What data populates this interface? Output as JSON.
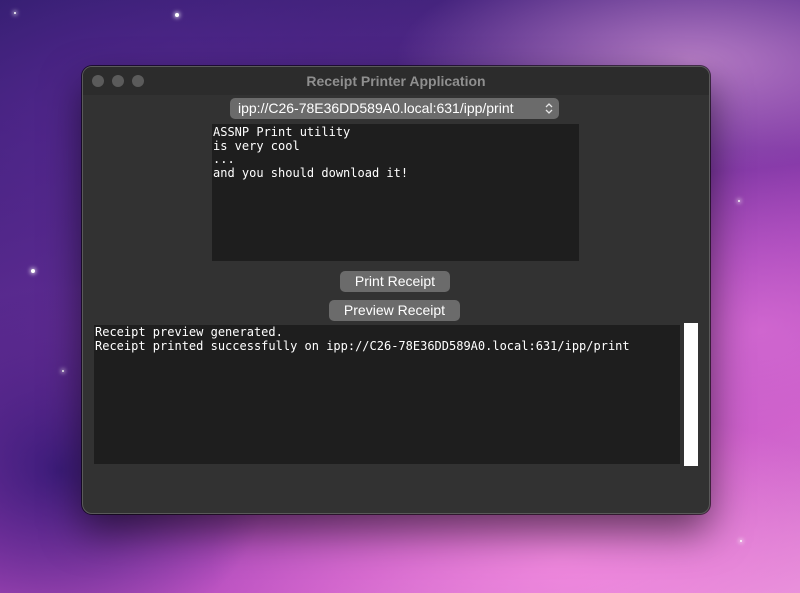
{
  "window": {
    "title": "Receipt Printer Application"
  },
  "printer_select": {
    "selected": "ipp://C26-78E36DD589A0.local:631/ipp/print",
    "icon": "chevron-up-down-icon"
  },
  "receipt_text": {
    "lines": [
      "ASSNP Print utility",
      "is very cool",
      "...",
      "and you should download it!"
    ]
  },
  "buttons": {
    "print": "Print Receipt",
    "preview": "Preview Receipt"
  },
  "log": {
    "lines": [
      "Receipt preview generated.",
      "Receipt printed successfully on ipp://C26-78E36DD589A0.local:631/ipp/print"
    ]
  },
  "colors": {
    "window_bg": "#323232",
    "field_bg": "#1e1e1e",
    "button_bg": "#6b6b6b",
    "text": "#ffffff"
  }
}
